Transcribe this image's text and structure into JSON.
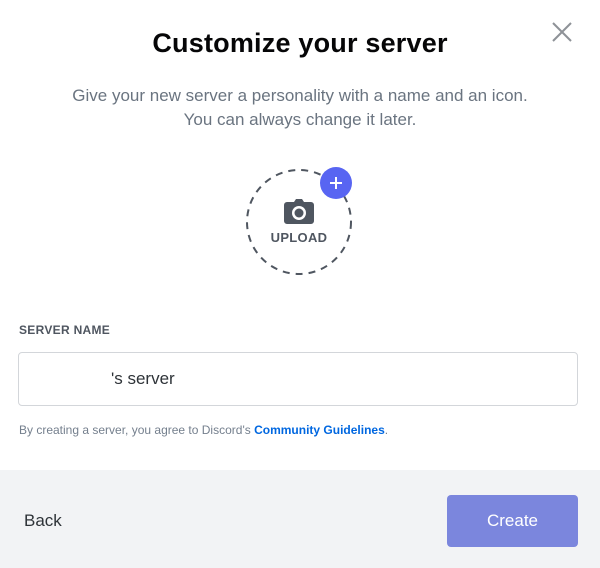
{
  "modal": {
    "title": "Customize your server",
    "subtitle_line1": "Give your new server a personality with a name and an icon.",
    "subtitle_line2": "You can always change it later."
  },
  "upload": {
    "label": "UPLOAD",
    "icon": "camera-icon",
    "badge_icon": "plus-icon",
    "accent_color": "#5865f2"
  },
  "form": {
    "server_name_label": "SERVER NAME",
    "server_name_value": "'s server",
    "terms_prefix": "By creating a server, you agree to Discord's ",
    "terms_link": "Community Guidelines",
    "terms_suffix": "."
  },
  "footer": {
    "back_label": "Back",
    "create_label": "Create",
    "create_color": "#7b86dd"
  },
  "icons": {
    "close": "close-icon"
  }
}
